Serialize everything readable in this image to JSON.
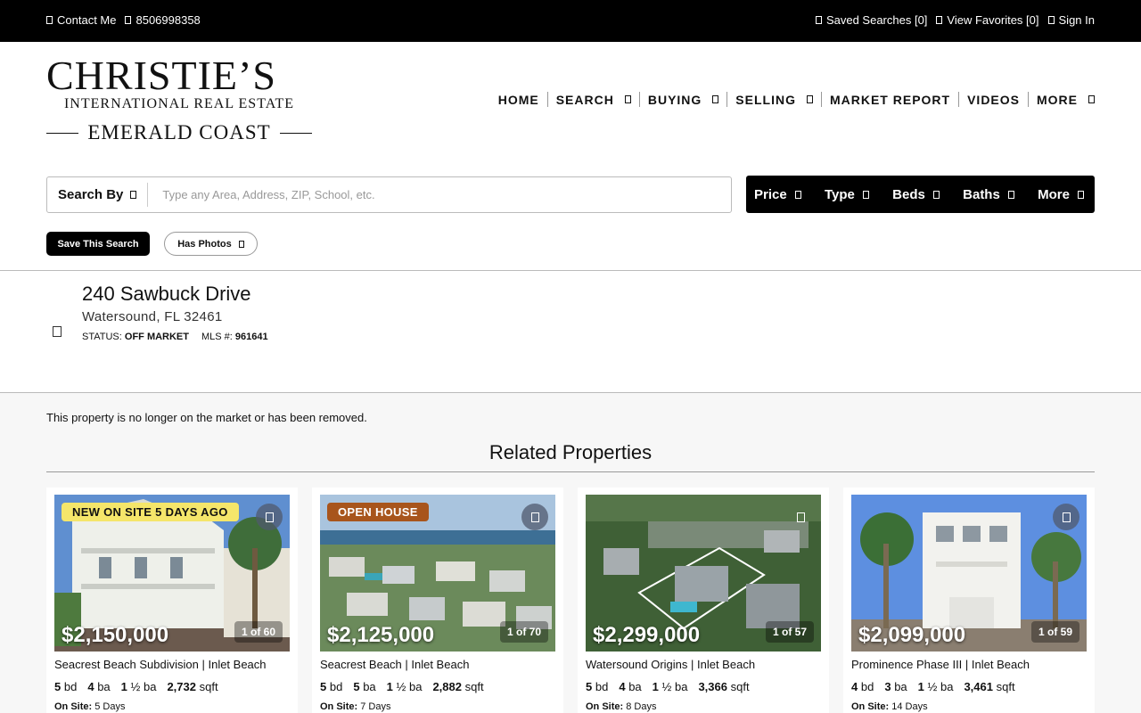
{
  "topbar": {
    "contact_label": "Contact Me",
    "phone": "8506998358",
    "saved_searches": "Saved Searches [0]",
    "view_favorites": "View Favorites [0]",
    "sign_in": "Sign In"
  },
  "logo": {
    "line1": "CHRISTIE’S",
    "line2": "INTERNATIONAL REAL ESTATE",
    "line3": "EMERALD COAST"
  },
  "nav": {
    "home": "HOME",
    "search": "SEARCH",
    "buying": "BUYING",
    "selling": "SELLING",
    "market_report": "MARKET REPORT",
    "videos": "VIDEOS",
    "more": "MORE"
  },
  "search": {
    "search_by": "Search By",
    "placeholder": "Type any Area, Address, ZIP, School, etc.",
    "value": ""
  },
  "filters": {
    "price": "Price",
    "type": "Type",
    "beds": "Beds",
    "baths": "Baths",
    "more": "More"
  },
  "actions": {
    "save_search": "Save This Search",
    "has_photos": "Has Photos"
  },
  "property": {
    "address": "240 Sawbuck Drive",
    "city_state_zip": "Watersound, FL 32461",
    "status_label": "STATUS:",
    "status_value": "OFF MARKET",
    "mls_label": "MLS #:",
    "mls_value": "961641"
  },
  "notice": "This property is no longer on the market or has been removed.",
  "related": {
    "heading": "Related Properties",
    "onsite_label": "On Site:",
    "cards": [
      {
        "badge": "NEW ON SITE 5 DAYS AGO",
        "badge_bg": "#f5e66a",
        "badge_fg": "#111111",
        "price": "$2,150,000",
        "photo_count": "1 of 60",
        "title": "Seacrest Beach Subdivision | Inlet Beach",
        "bd": "5",
        "ba": "4",
        "half_ba": "1",
        "sqft": "2,732",
        "onsite": "5 Days"
      },
      {
        "badge": "OPEN HOUSE",
        "badge_bg": "#a8551c",
        "badge_fg": "#ffffff",
        "price": "$2,125,000",
        "photo_count": "1 of 70",
        "title": "Seacrest Beach | Inlet Beach",
        "bd": "5",
        "ba": "5",
        "half_ba": "1",
        "sqft": "2,882",
        "onsite": "7 Days"
      },
      {
        "badge": "",
        "price": "$2,299,000",
        "photo_count": "1 of 57",
        "title": "Watersound Origins | Inlet Beach",
        "bd": "5",
        "ba": "4",
        "half_ba": "1",
        "sqft": "3,366",
        "onsite": "8 Days"
      },
      {
        "badge": "",
        "price": "$2,099,000",
        "photo_count": "1 of 59",
        "title": "Prominence Phase III | Inlet Beach",
        "bd": "4",
        "ba": "3",
        "half_ba": "1",
        "sqft": "3,461",
        "onsite": "14 Days"
      }
    ],
    "units": {
      "bd": "bd",
      "ba": "ba",
      "half_ba": "½ ba",
      "sqft": "sqft"
    }
  }
}
